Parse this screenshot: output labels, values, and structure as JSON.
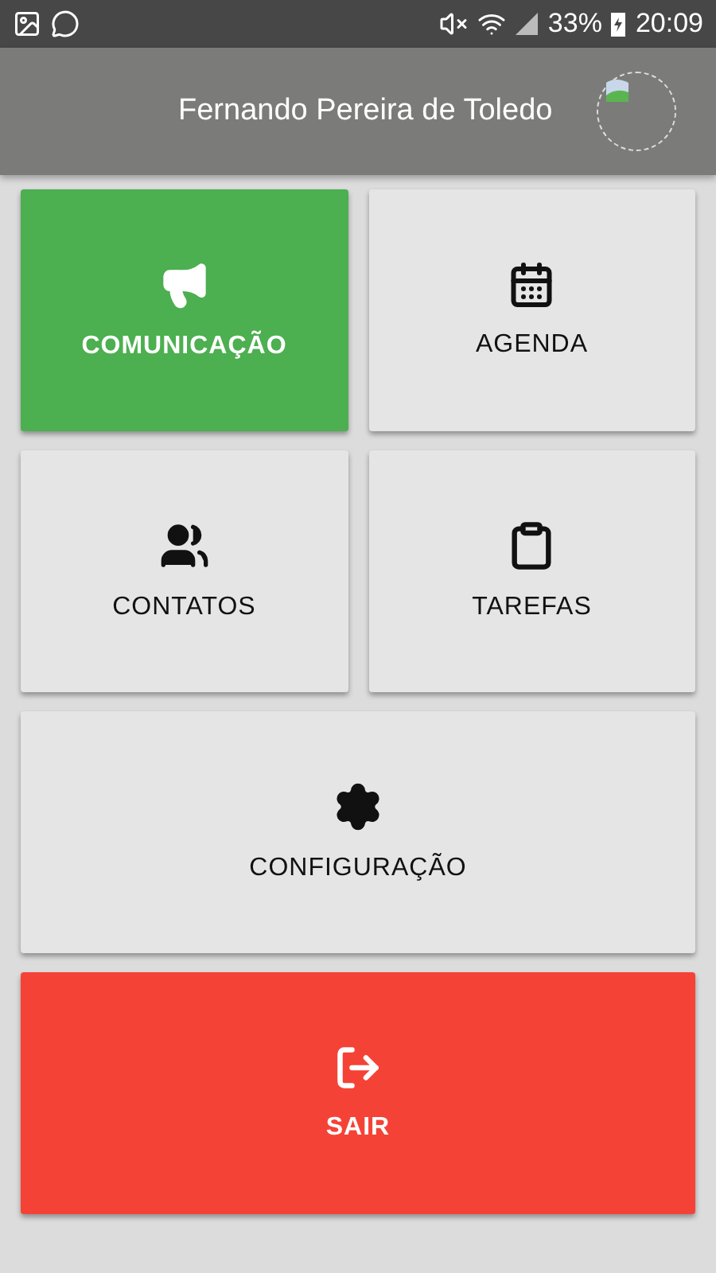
{
  "status_bar": {
    "battery": "33%",
    "time": "20:09"
  },
  "header": {
    "user_name": "Fernando Pereira de Toledo"
  },
  "menu": [
    {
      "label": "COMUNICAÇÃO",
      "kind": "accent",
      "wide": false
    },
    {
      "label": "AGENDA",
      "kind": "plain",
      "wide": false
    },
    {
      "label": "CONTATOS",
      "kind": "plain",
      "wide": false
    },
    {
      "label": "TAREFAS",
      "kind": "plain",
      "wide": false
    },
    {
      "label": "CONFIGURAÇÃO",
      "kind": "plain",
      "wide": true
    },
    {
      "label": "SAIR",
      "kind": "danger",
      "wide": true
    }
  ]
}
